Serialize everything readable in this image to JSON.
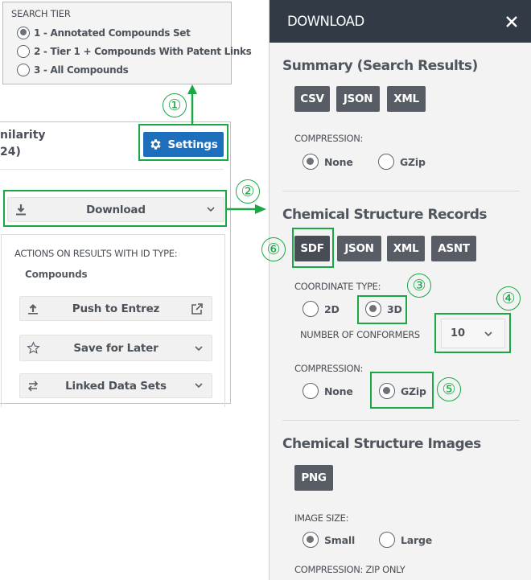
{
  "search_tier": {
    "title": "SEARCH TIER",
    "options": [
      {
        "label": "1 - Annotated Compounds Set",
        "checked": true
      },
      {
        "label": "2 - Tier 1 + Compounds With Patent Links",
        "checked": false
      },
      {
        "label": "3 - All Compounds",
        "checked": false
      }
    ]
  },
  "results_panel": {
    "title_partial": "nilarity\n24)",
    "settings_label": "Settings",
    "download_label": "Download",
    "actions_title": "ACTIONS ON RESULTS WITH ID TYPE:",
    "id_type": "Compounds",
    "actions": [
      {
        "label": "Push to Entrez",
        "icon": "upload-icon",
        "trail_icon": "external-link-icon"
      },
      {
        "label": "Save for Later",
        "icon": "star-icon",
        "trail_icon": "chevron-down-icon"
      },
      {
        "label": "Linked Data Sets",
        "icon": "swap-arrows-icon",
        "trail_icon": "chevron-down-icon"
      }
    ]
  },
  "download_panel": {
    "title": "DOWNLOAD",
    "close_icon": "close-icon",
    "summary": {
      "title": "Summary (Search Results)",
      "formats": [
        "CSV",
        "JSON",
        "XML"
      ],
      "compression_label": "COMPRESSION:",
      "compression_options": [
        {
          "label": "None",
          "checked": true
        },
        {
          "label": "GZip",
          "checked": false
        }
      ]
    },
    "records": {
      "title": "Chemical Structure Records",
      "formats": [
        "SDF",
        "JSON",
        "XML",
        "ASNT"
      ],
      "selected_format": "SDF",
      "coordinate_label": "COORDINATE TYPE:",
      "coordinate_options": [
        {
          "label": "2D",
          "checked": false
        },
        {
          "label": "3D",
          "checked": true
        }
      ],
      "conformers_label": "NUMBER OF CONFORMERS",
      "conformers_value": "10",
      "compression_label": "COMPRESSION:",
      "compression_options": [
        {
          "label": "None",
          "checked": false
        },
        {
          "label": "GZip",
          "checked": true
        }
      ]
    },
    "images": {
      "title": "Chemical Structure Images",
      "formats": [
        "PNG"
      ],
      "size_label": "IMAGE SIZE:",
      "size_options": [
        {
          "label": "Small",
          "checked": true
        },
        {
          "label": "Large",
          "checked": false
        }
      ],
      "compression_label": "COMPRESSION: ZIP ONLY"
    }
  },
  "annotations": {
    "color": "#1aa845",
    "markers": [
      "①",
      "②",
      "③",
      "④",
      "⑤",
      "⑥"
    ]
  }
}
